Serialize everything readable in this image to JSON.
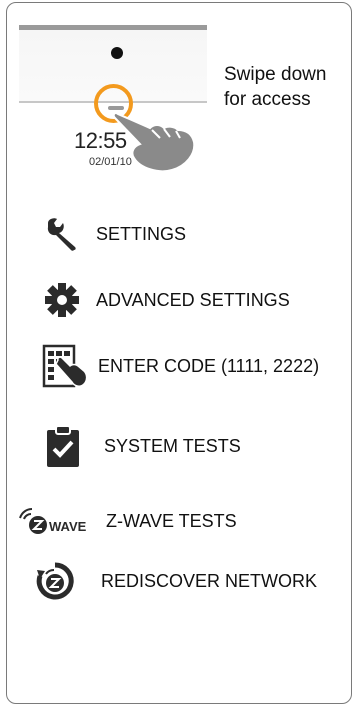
{
  "hint": {
    "time": "12:55",
    "date": "02/01/10",
    "instruction_line1": "Swipe down",
    "instruction_line2": "for access"
  },
  "menu": [
    {
      "label": "SETTINGS",
      "icon": "wrench-icon"
    },
    {
      "label": "ADVANCED SETTINGS",
      "icon": "gear-icon"
    },
    {
      "label": "ENTER CODE (1111, 2222)",
      "icon": "keypad-hand-icon"
    },
    {
      "label": "SYSTEM TESTS",
      "icon": "clipboard-check-icon"
    },
    {
      "label": "Z-WAVE TESTS",
      "icon": "zwave-logo-icon",
      "icon_text": "WAVE"
    },
    {
      "label": "REDISCOVER NETWORK",
      "icon": "zwave-rediscover-icon"
    }
  ],
  "colors": {
    "accent": "#f39a1e",
    "icon": "#2b2b2b",
    "border": "#7a7a7a"
  }
}
